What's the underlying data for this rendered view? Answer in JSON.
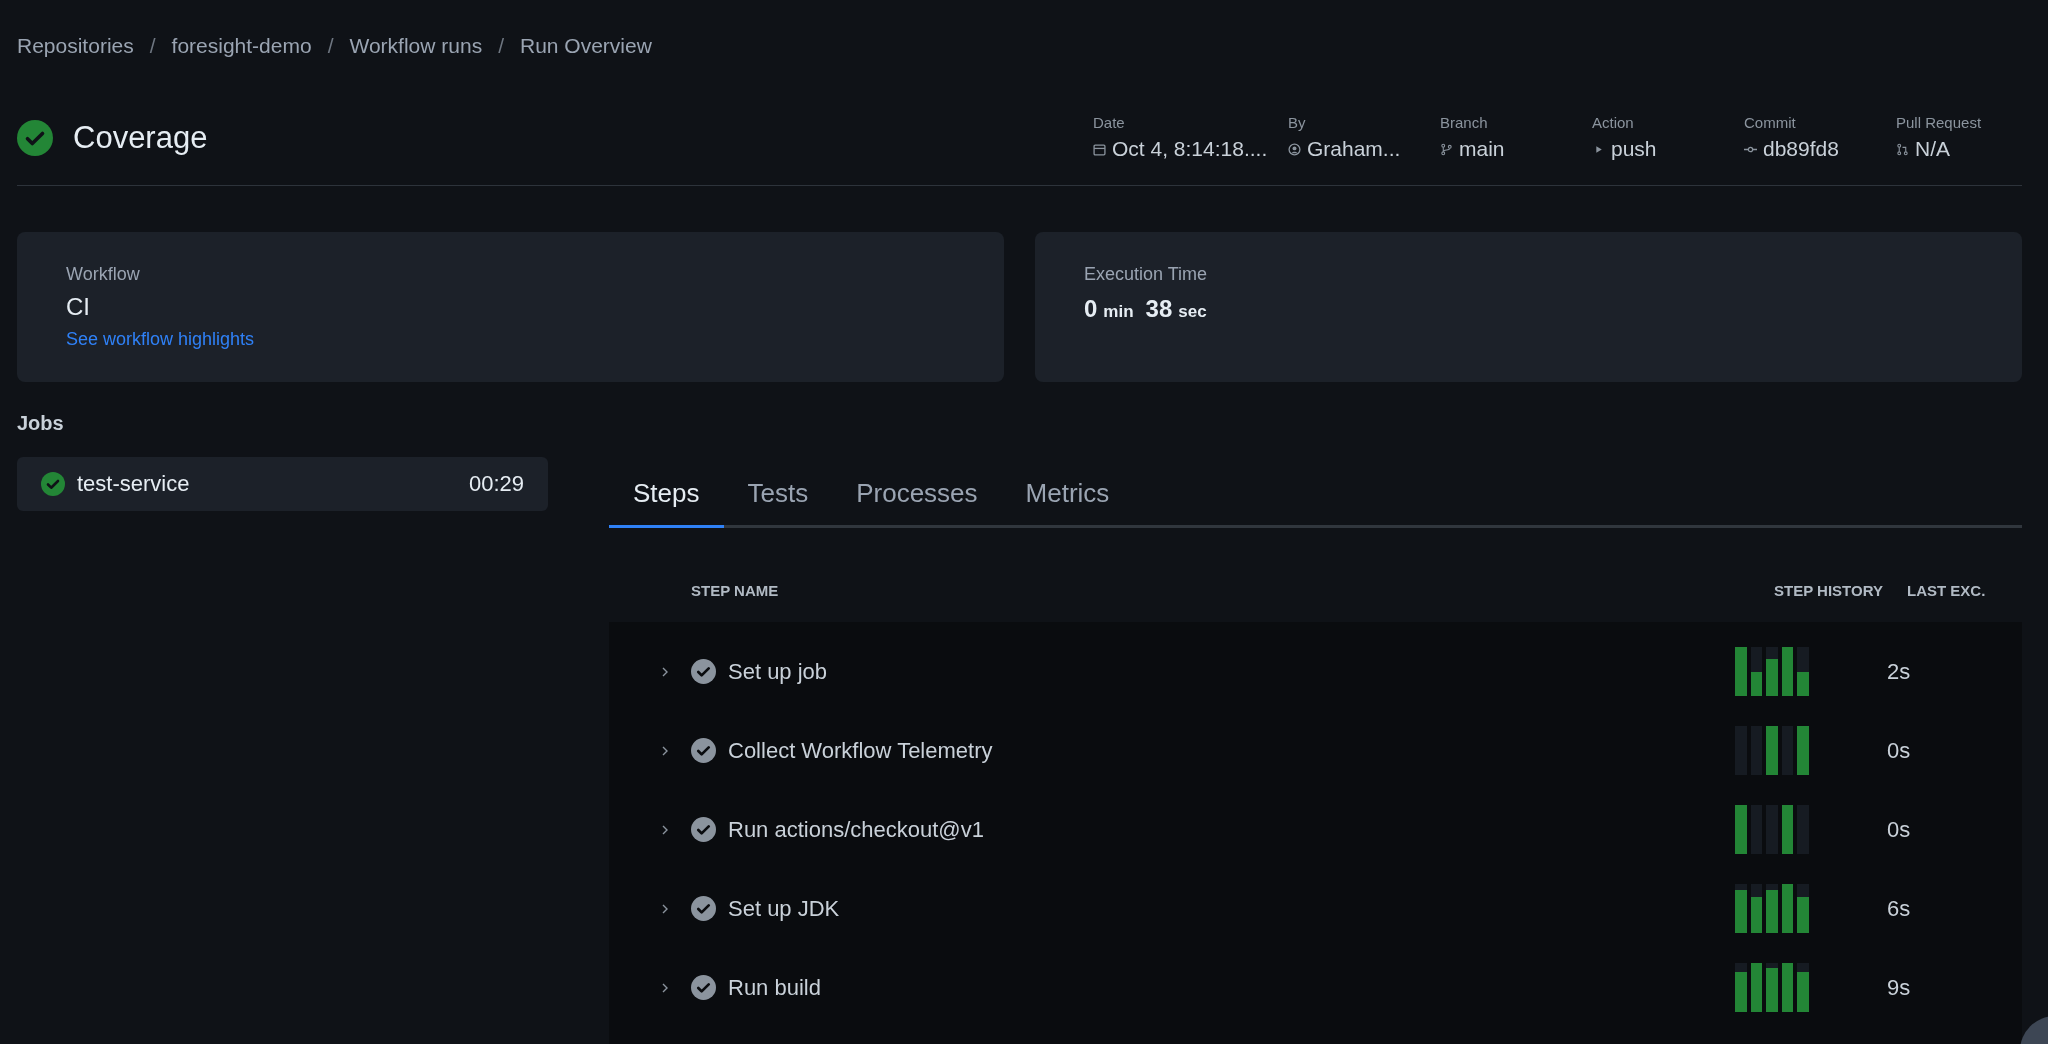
{
  "breadcrumbs": {
    "separator": "/",
    "items": [
      "Repositories",
      "foresight-demo",
      "Workflow runs",
      "Run Overview"
    ]
  },
  "run": {
    "title": "Coverage"
  },
  "meta": [
    {
      "kind": "date",
      "label": "Date",
      "value": "Oct 4, 8:14:18...."
    },
    {
      "kind": "user",
      "label": "By",
      "value": "Graham..."
    },
    {
      "kind": "branch",
      "label": "Branch",
      "value": "main"
    },
    {
      "kind": "action",
      "label": "Action",
      "value": "push"
    },
    {
      "kind": "commit",
      "label": "Commit",
      "value": "db89fd8"
    },
    {
      "kind": "pr",
      "label": "Pull Request",
      "value": "N/A"
    }
  ],
  "workflow_card": {
    "label": "Workflow",
    "value": "CI",
    "link": "See workflow highlights"
  },
  "execution_card": {
    "label": "Execution Time",
    "minutes": "0",
    "min_unit": "min",
    "seconds": "38",
    "sec_unit": "sec"
  },
  "jobs": {
    "title": "Jobs",
    "items": [
      {
        "name": "test-service",
        "duration": "00:29",
        "selected": true
      }
    ]
  },
  "tabs": [
    {
      "label": "Steps",
      "selected": true
    },
    {
      "label": "Tests",
      "selected": false
    },
    {
      "label": "Processes",
      "selected": false
    },
    {
      "label": "Metrics",
      "selected": false
    }
  ],
  "steps_table": {
    "columns": [
      "STEP NAME",
      "STEP HISTORY",
      "LAST EXC."
    ],
    "rows": [
      {
        "name": "Set up job",
        "last": "2s",
        "history": [
          {
            "level": 1
          },
          {
            "level": 0.5
          },
          {
            "level": 0.75
          },
          {
            "level": 1
          },
          {
            "level": 0.5
          }
        ]
      },
      {
        "name": "Collect Workflow Telemetry",
        "last": "0s",
        "history": [
          {
            "level": 0
          },
          {
            "level": 0
          },
          {
            "level": 1
          },
          {
            "level": 0
          },
          {
            "level": 1
          }
        ]
      },
      {
        "name": "Run actions/checkout@v1",
        "last": "0s",
        "history": [
          {
            "level": 1
          },
          {
            "level": 0
          },
          {
            "level": 0
          },
          {
            "level": 1
          },
          {
            "level": 0
          }
        ]
      },
      {
        "name": "Set up JDK",
        "last": "6s",
        "history": [
          {
            "level": 0.87
          },
          {
            "level": 0.74
          },
          {
            "level": 0.87
          },
          {
            "level": 1
          },
          {
            "level": 0.74
          }
        ]
      },
      {
        "name": "Run build",
        "last": "9s",
        "history": [
          {
            "level": 0.81
          },
          {
            "level": 1
          },
          {
            "level": 0.9
          },
          {
            "level": 1
          },
          {
            "level": 0.81
          }
        ]
      }
    ]
  }
}
